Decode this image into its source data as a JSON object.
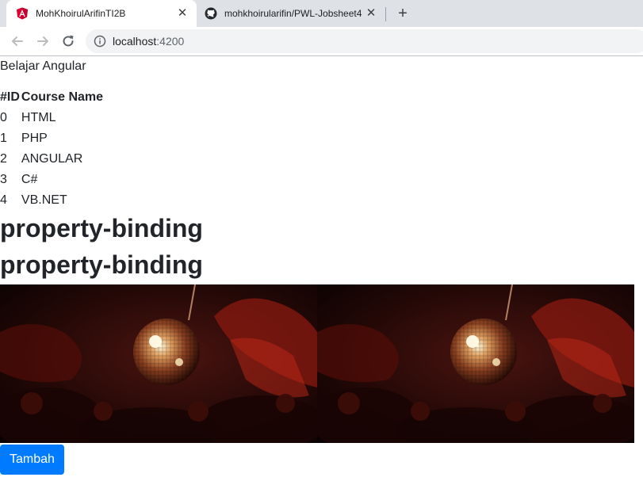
{
  "browser": {
    "tabs": [
      {
        "title": "MohKhoirulArifinTI2B",
        "favicon": "angular-icon",
        "active": true
      },
      {
        "title": "mohkhoirularifin/PWL-Jobsheet4",
        "favicon": "github-icon",
        "active": false
      }
    ],
    "url_host": "localhost",
    "url_port": ":4200"
  },
  "page": {
    "intro": "Belajar Angular",
    "table": {
      "headers": [
        "#ID",
        "Course Name"
      ],
      "rows": [
        {
          "id": "0",
          "name": "HTML"
        },
        {
          "id": "1",
          "name": "PHP"
        },
        {
          "id": "2",
          "name": "ANGULAR"
        },
        {
          "id": "3",
          "name": "C#"
        },
        {
          "id": "4",
          "name": "VB.NET"
        }
      ]
    },
    "binding_titles": [
      "property-binding",
      "property-binding"
    ],
    "button_label": "Tambah",
    "colors": {
      "primary": "#007bff",
      "text": "#212529"
    }
  }
}
